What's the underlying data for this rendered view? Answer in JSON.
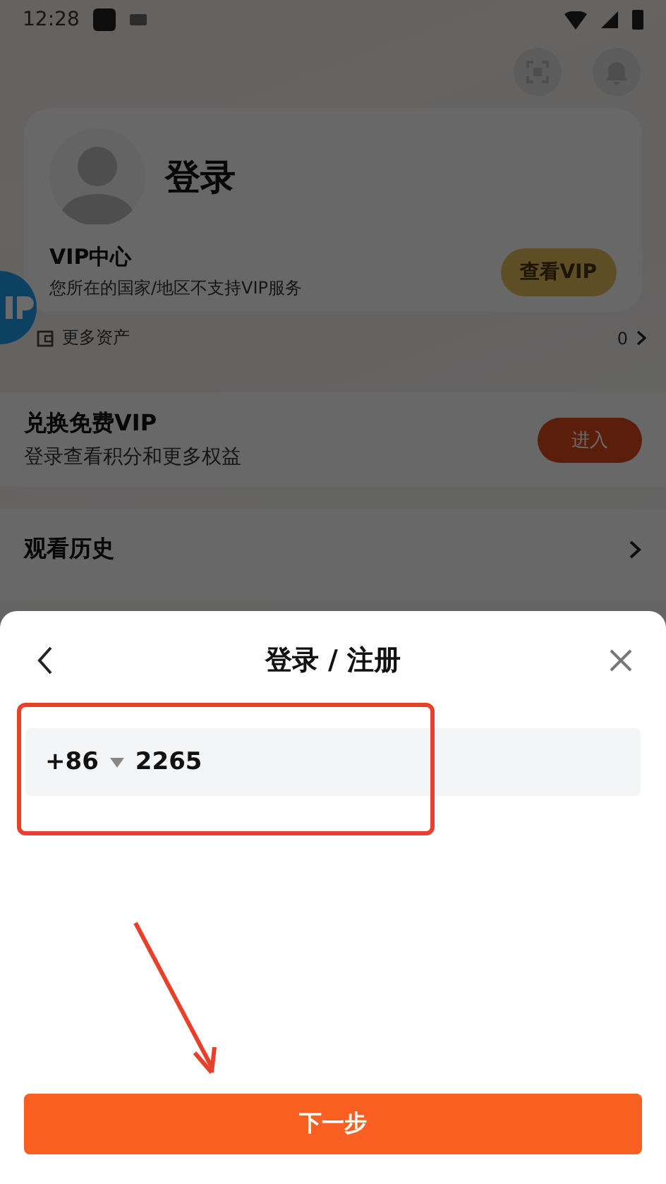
{
  "status_bar": {
    "time": "12:28"
  },
  "profile": {
    "name": "登录",
    "vip_title": "VIP中心",
    "vip_note": "您所在的国家/地区不支持VIP服务",
    "vip_button": "查看VIP",
    "assets_label": "更多资产",
    "assets_count": "0"
  },
  "redeem": {
    "title": "兑换免费VIP",
    "subtitle": "登录查看积分和更多权益",
    "button": "进入"
  },
  "history": {
    "title": "观看历史"
  },
  "sheet": {
    "title": "登录 / 注册",
    "country_code": "+86",
    "phone": "2265",
    "next_button": "下一步"
  }
}
